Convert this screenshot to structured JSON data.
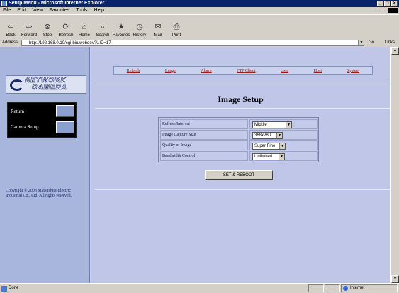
{
  "window": {
    "title": "Setup Menu - Microsoft Internet Explorer"
  },
  "menu": [
    "File",
    "Edit",
    "View",
    "Favorites",
    "Tools",
    "Help"
  ],
  "toolbar": [
    {
      "label": "Back",
      "icon": "back-arrow-icon",
      "glyph": "⇦"
    },
    {
      "label": "Forward",
      "icon": "forward-arrow-icon",
      "glyph": "⇨"
    },
    {
      "label": "Stop",
      "icon": "stop-icon",
      "glyph": "⊗"
    },
    {
      "label": "Refresh",
      "icon": "refresh-icon",
      "glyph": "⟳"
    },
    {
      "label": "Home",
      "icon": "home-icon",
      "glyph": "⌂"
    },
    {
      "label": "Search",
      "icon": "search-icon",
      "glyph": "⌕"
    },
    {
      "label": "Favorites",
      "icon": "favorites-icon",
      "glyph": "★"
    },
    {
      "label": "History",
      "icon": "history-icon",
      "glyph": "◷"
    },
    {
      "label": "Mail",
      "icon": "mail-icon",
      "glyph": "✉"
    },
    {
      "label": "Print",
      "icon": "print-icon",
      "glyph": "⎙"
    }
  ],
  "address": {
    "label": "Address",
    "url": "http://192.168.0.10/cgi-bin/webdev?UID=17",
    "go": "Go",
    "links": "Links"
  },
  "brand": {
    "line1": "NETWORK",
    "line2": "CAMERA"
  },
  "sidebar": {
    "nav": [
      "Return",
      "Camera Setup"
    ],
    "copyright": "Copyright © 2003 Matsushita Electric Industrial Co., Ltd. All rights reserved."
  },
  "nav_links": [
    "Refresh",
    "Image",
    "Alarm",
    "FTP Client",
    "User",
    "Host",
    "System"
  ],
  "page_title": "Image Setup",
  "form": [
    {
      "label": "Refresh Interval",
      "value": "Middle"
    },
    {
      "label": "Image Capture Size",
      "value": "368x280"
    },
    {
      "label": "Quality of Image",
      "value": "Super Fine"
    },
    {
      "label": "Bandwidth Control",
      "value": "Unlimited"
    }
  ],
  "submit_label": "SET & REBOOT",
  "status": {
    "text": "Done",
    "zone": "Internet"
  }
}
